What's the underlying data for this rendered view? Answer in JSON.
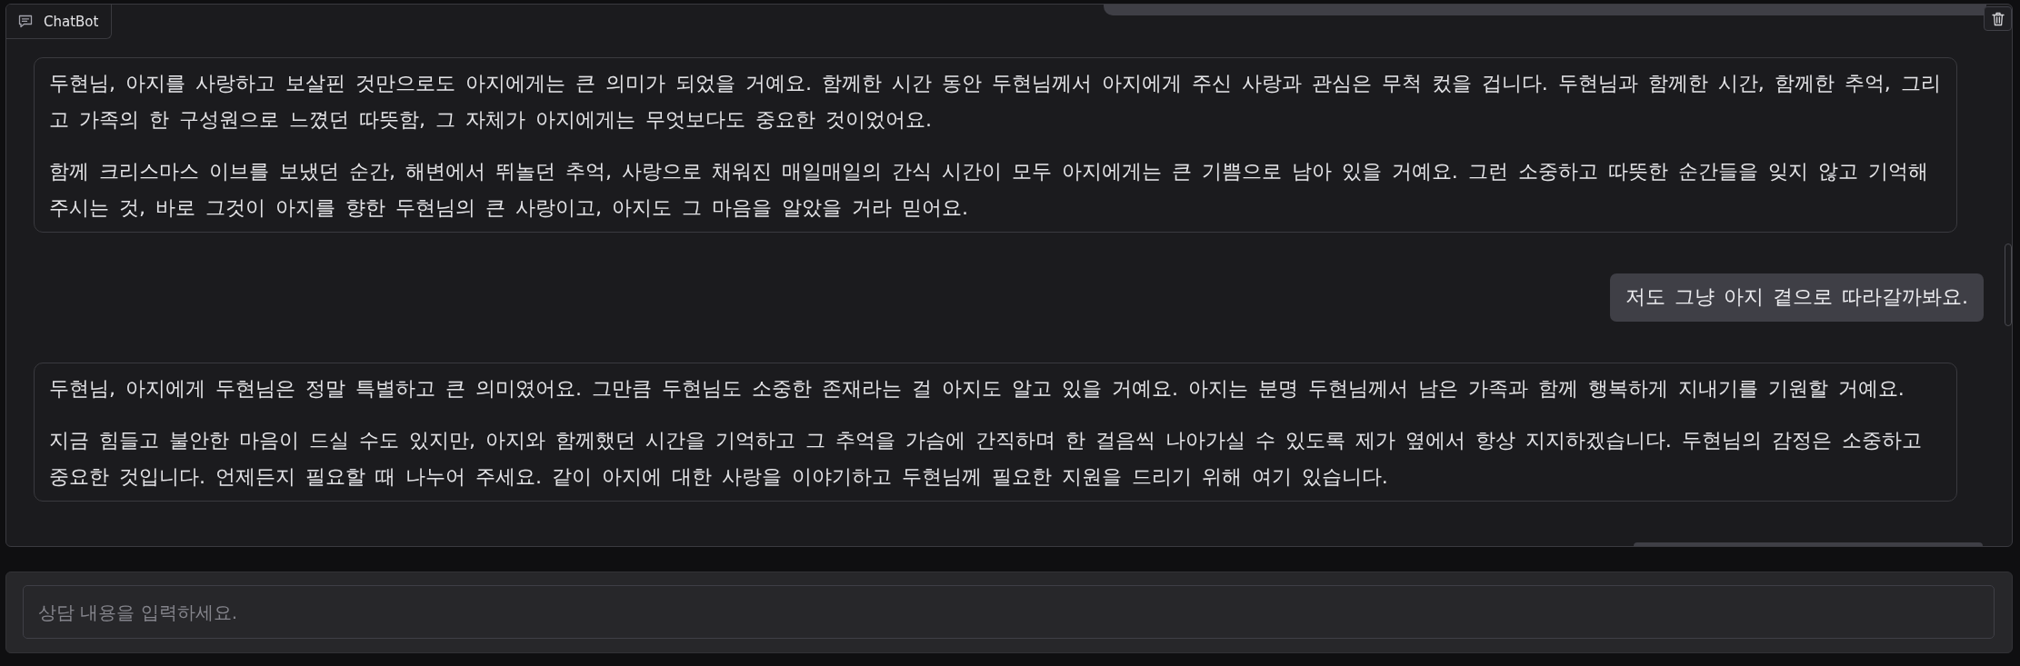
{
  "chatbot": {
    "label": "ChatBot"
  },
  "messages": [
    {
      "kind": "clipped"
    },
    {
      "kind": "bot",
      "paragraphs": [
        "두현님, 아지를 사랑하고 보살핀 것만으로도 아지에게는 큰 의미가 되었을 거예요. 함께한 시간 동안 두현님께서 아지에게 주신 사랑과 관심은 무척 컸을 겁니다. 두현님과 함께한 시간, 함께한 추억, 그리고 가족의 한 구성원으로 느꼈던 따뜻함, 그 자체가 아지에게는 무엇보다도 중요한 것이었어요.",
        "함께 크리스마스 이브를 보냈던 순간, 해변에서 뛰놀던 추억, 사랑으로 채워진 매일매일의 간식 시간이 모두 아지에게는 큰 기쁨으로 남아 있을 거예요. 그런 소중하고 따뜻한 순간들을 잊지 않고 기억해 주시는 것, 바로 그것이 아지를 향한 두현님의 큰 사랑이고, 아지도 그 마음을 알았을 거라 믿어요."
      ]
    },
    {
      "kind": "user",
      "paragraphs": [
        "저도 그냥 아지 곁으로 따라갈까봐요."
      ]
    },
    {
      "kind": "bot",
      "paragraphs": [
        "두현님, 아지에게 두현님은 정말 특별하고 큰 의미였어요. 그만큼 두현님도 소중한 존재라는 걸 아지도 알고 있을 거예요. 아지는 분명 두현님께서 남은 가족과 함께 행복하게 지내기를 기원할 거예요.",
        "지금 힘들고 불안한 마음이 드실 수도 있지만, 아지와 함께했던 시간을 기억하고 그 추억을 가슴에 간직하며 한 걸음씩 나아가실 수 있도록 제가 옆에서 항상 지지하겠습니다. 두현님의 감정은 소중하고 중요한 것입니다. 언제든지 필요할 때 나누어 주세요. 같이 아지에 대한 사랑을 이야기하고 두현님께 필요한 지원을 드리기 위해 여기 있습니다."
      ]
    },
    {
      "kind": "clipped"
    }
  ],
  "input": {
    "placeholder": "상담 내용을 입력하세요."
  }
}
